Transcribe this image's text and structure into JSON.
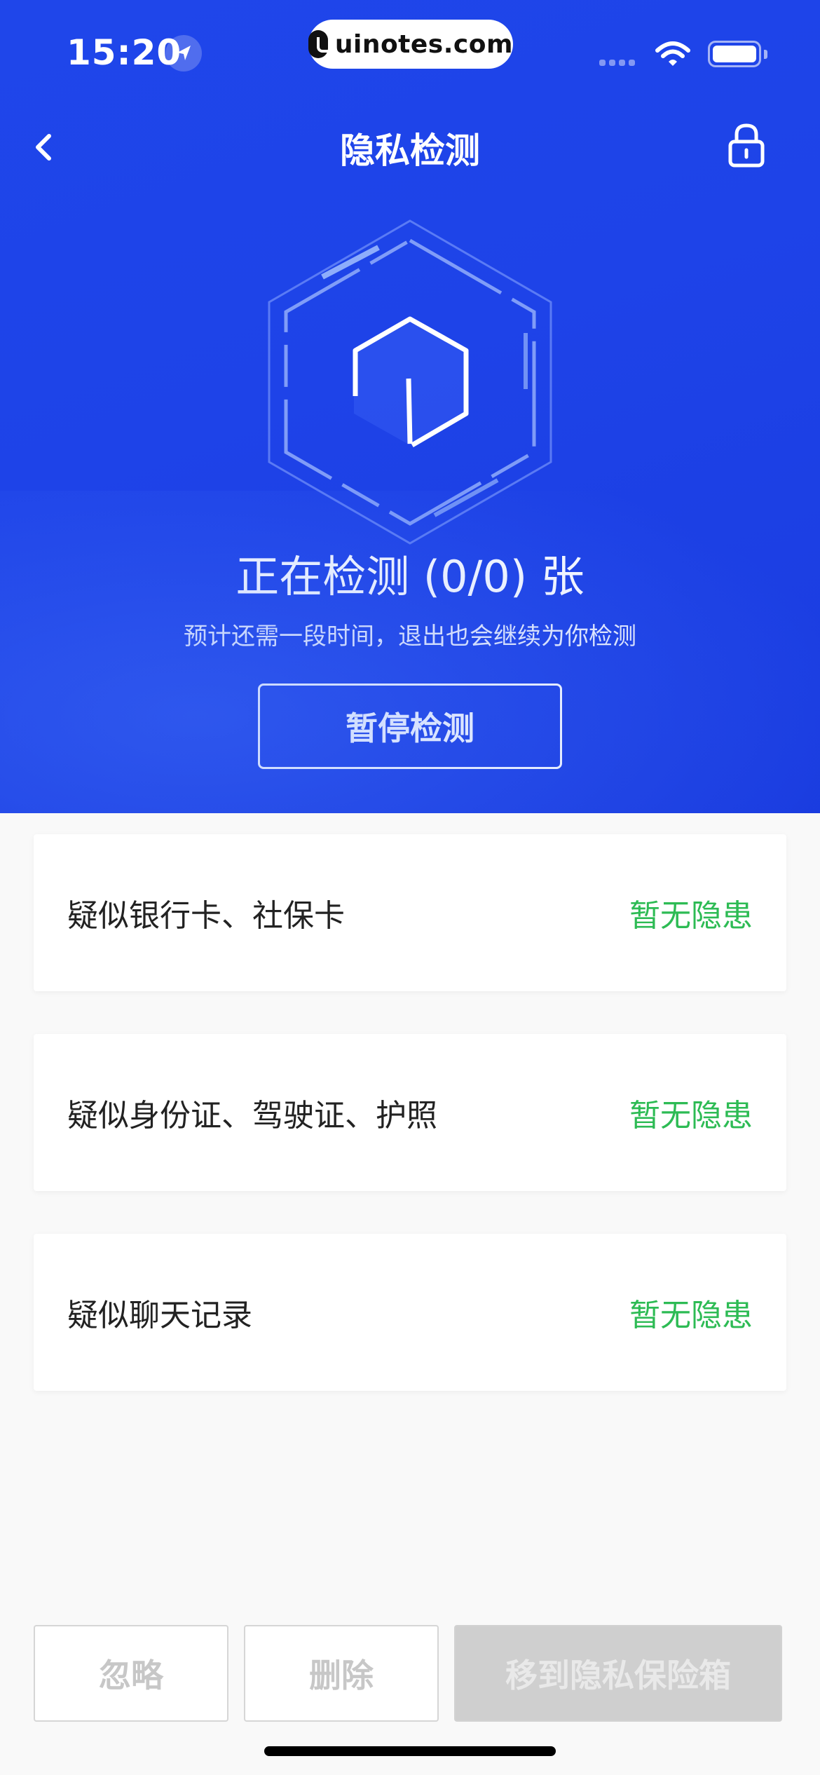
{
  "status_bar": {
    "time": "15:20",
    "url": "uinotes.com",
    "icons": [
      "location-arrow-icon",
      "signal-icon",
      "wifi-icon",
      "battery-icon"
    ]
  },
  "nav": {
    "title": "隐私检测",
    "back_icon": "chevron-left-icon",
    "right_icon": "lock-icon"
  },
  "scan": {
    "title": "正在检测 (0/0) 张",
    "subtitle": "预计还需一段时间，退出也会继续为你检测",
    "pause_label": "暂停检测"
  },
  "categories": [
    {
      "label": "疑似银行卡、社保卡",
      "status": "暂无隐患"
    },
    {
      "label": "疑似身份证、驾驶证、护照",
      "status": "暂无隐患"
    },
    {
      "label": "疑似聊天记录",
      "status": "暂无隐患"
    }
  ],
  "actions": {
    "ignore_label": "忽略",
    "delete_label": "删除",
    "move_label": "移到隐私保险箱"
  },
  "colors": {
    "brand_blue": "#1e43e8",
    "safe_green": "#2dbb54",
    "disabled_gray": "#cfcfcf"
  }
}
